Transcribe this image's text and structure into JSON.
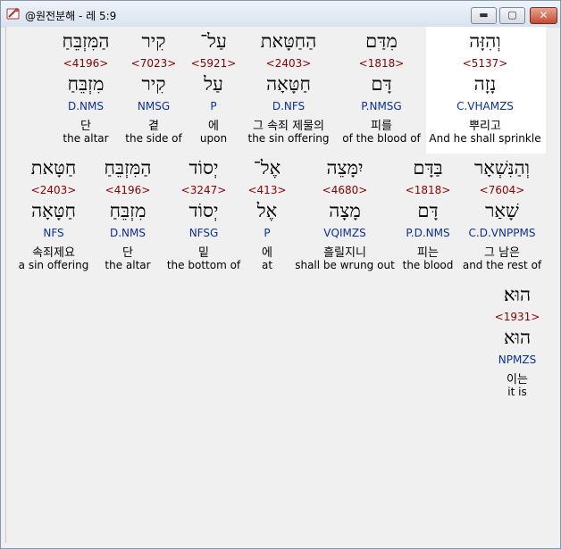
{
  "window": {
    "title": "@원전분해 - 레 5:9",
    "minimize": "▬",
    "maximize": "▢",
    "close": "✕"
  },
  "rows": [
    {
      "words": [
        {
          "surface": "וְהִזָּה",
          "strong": "<5137>",
          "lemma": "נָזָה",
          "parse": "C.VHAMZS",
          "kor": "뿌리고",
          "eng": "And he shall sprinkle"
        },
        {
          "surface": "מִדַּם",
          "strong": "<1818>",
          "lemma": "דָּם",
          "parse": "P.NMSG",
          "kor": "피를",
          "eng": "of the blood of"
        },
        {
          "surface": "הַחַטָּאת",
          "strong": "<2403>",
          "lemma": "חַטָּאָה",
          "parse": "D.NFS",
          "kor": "그 속죄 제물의",
          "eng": "the sin offering"
        },
        {
          "surface": "עַל־",
          "strong": "<5921>",
          "lemma": "עַל",
          "parse": "P",
          "kor": "에",
          "eng": "upon"
        },
        {
          "surface": "קִיר",
          "strong": "<7023>",
          "lemma": "קִיר",
          "parse": "NMSG",
          "kor": "곁",
          "eng": "the side of"
        },
        {
          "surface": "הַמִּזְבֵּחַ",
          "strong": "<4196>",
          "lemma": "מִזְבֵּחַ",
          "parse": "D.NMS",
          "kor": "단",
          "eng": "the altar"
        }
      ]
    },
    {
      "words": [
        {
          "surface": "וְהַנִּשְׁאָר",
          "strong": "<7604>",
          "lemma": "שָׁאַר",
          "parse": "C.D.VNPPMS",
          "kor": "그 남은",
          "eng": "and the rest of"
        },
        {
          "surface": "בַּדָּם",
          "strong": "<1818>",
          "lemma": "דָּם",
          "parse": "P.D.NMS",
          "kor": "피는",
          "eng": "the blood"
        },
        {
          "surface": "יִמָּצֵה",
          "strong": "<4680>",
          "lemma": "מָצָה",
          "parse": "VQIMZS",
          "kor": "흘릴지니",
          "eng": "shall be wrung out"
        },
        {
          "surface": "אֶל־",
          "strong": "<413>",
          "lemma": "אֶל",
          "parse": "P",
          "kor": "에",
          "eng": "at"
        },
        {
          "surface": "יְסוֹד",
          "strong": "<3247>",
          "lemma": "יְסוֹד",
          "parse": "NFSG",
          "kor": "밑",
          "eng": "the bottom of"
        },
        {
          "surface": "הַמִּזְבֵּחַ",
          "strong": "<4196>",
          "lemma": "מִזְבֵּחַ",
          "parse": "D.NMS",
          "kor": "단",
          "eng": "the altar"
        },
        {
          "surface": "חַטָּאת",
          "strong": "<2403>",
          "lemma": "חַטָּאָה",
          "parse": "NFS",
          "kor": "속죄제요",
          "eng": "a sin offering"
        }
      ]
    },
    {
      "words": [
        {
          "surface": "הוּא׃",
          "strong": "<1931>",
          "lemma": "הוּא",
          "parse": "NPMZS",
          "kor": "이는",
          "eng": "it is"
        }
      ]
    }
  ]
}
